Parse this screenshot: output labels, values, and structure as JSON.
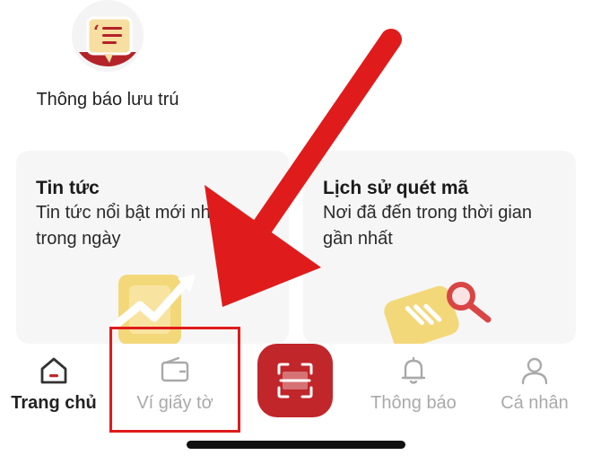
{
  "top_item": {
    "label": "Thông báo lưu trú",
    "icon": "accommodation-notice-icon"
  },
  "cards": [
    {
      "title": "Tin tức",
      "description": "Tin tức nổi bật mới nhất trong ngày",
      "icon": "news-chart-icon"
    },
    {
      "title": "Lịch sử quét mã",
      "description": "Nơi đã đến trong thời gian gần nhất",
      "icon": "scan-history-icon"
    }
  ],
  "bottom_nav": {
    "home": {
      "label": "Trang chủ",
      "icon": "home-icon"
    },
    "wallet": {
      "label": "Ví giấy tờ",
      "icon": "wallet-icon"
    },
    "scan": {
      "icon": "qr-scan-icon"
    },
    "notifications": {
      "label": "Thông báo",
      "icon": "bell-icon"
    },
    "profile": {
      "label": "Cá nhân",
      "icon": "user-icon"
    }
  },
  "colors": {
    "brand_red": "#c0262a",
    "highlight_red": "#e01b1b",
    "inactive_gray": "#a9a9a9",
    "card_bg": "#f6f6f6",
    "accent_yellow": "#f3d87a"
  }
}
